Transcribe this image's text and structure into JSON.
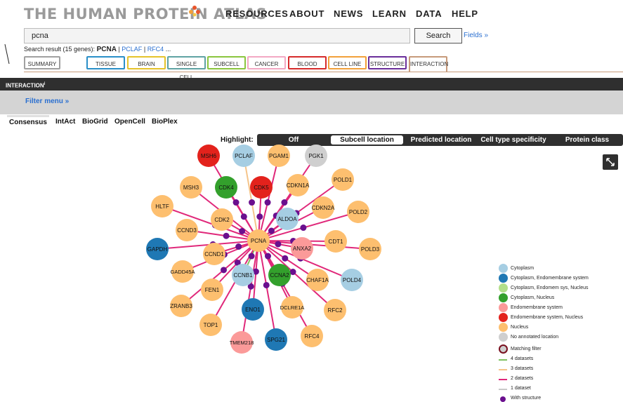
{
  "header": {
    "logo_text": "THE HUMAN PROTEIN ATLAS",
    "nav": [
      "RESOURCES",
      "ABOUT",
      "NEWS",
      "LEARN",
      "DATA",
      "HELP"
    ]
  },
  "search": {
    "value": "pcna",
    "button_label": "Search",
    "fields_link": "Fields »",
    "result_prefix": "Search result (15 genes):",
    "result_main": "PCNA",
    "result_sep1": "|",
    "result_gene2": "PCLAF",
    "result_sep2": "|",
    "result_gene3": "RFC4",
    "result_more": "..."
  },
  "tabs": [
    {
      "label": "SUMMARY",
      "color": "#a0a0a0"
    },
    {
      "label": "TISSUE",
      "color": "#2a8fc8"
    },
    {
      "label": "BRAIN",
      "color": "#e5c32b"
    },
    {
      "label": "SINGLE CELL",
      "color": "#5fa3a3"
    },
    {
      "label": "SUBCELL",
      "color": "#8ac53e"
    },
    {
      "label": "CANCER",
      "color": "#f3a8c3"
    },
    {
      "label": "BLOOD",
      "color": "#d62b2b"
    },
    {
      "label": "CELL LINE",
      "color": "#f2a03a"
    },
    {
      "label": "STRUCTURE",
      "color": "#6a2e9a"
    },
    {
      "label": "INTERACTION",
      "color": "#c79a7a"
    }
  ],
  "section": {
    "title": "INTERACTION",
    "superscript": "i",
    "filter_menu": "Filter menu »"
  },
  "dataset_tabs": [
    "Consensus",
    "IntAct",
    "BioGrid",
    "OpenCell",
    "BioPlex"
  ],
  "highlight": {
    "label": "Highlight:",
    "options": [
      "Off",
      "Subcell location",
      "Predicted location",
      "Cell type specificity",
      "Protein class"
    ],
    "active": "Subcell location"
  },
  "network": {
    "center": {
      "label": "PCNA",
      "color": "#fdbf6f"
    },
    "nodes": [
      {
        "label": "MSH6",
        "color": "#e3221c"
      },
      {
        "label": "PCLAF",
        "color": "#a6cee3"
      },
      {
        "label": "PGAM1",
        "color": "#fdbf6f"
      },
      {
        "label": "PGK1",
        "color": "#cfcfcf"
      },
      {
        "label": "MSH3",
        "color": "#fdbf6f"
      },
      {
        "label": "CDK4",
        "color": "#33a02c"
      },
      {
        "label": "CDK5",
        "color": "#e3221c"
      },
      {
        "label": "CDKN1A",
        "color": "#fdbf6f"
      },
      {
        "label": "POLD1",
        "color": "#fdbf6f"
      },
      {
        "label": "HLTF",
        "color": "#fdbf6f"
      },
      {
        "label": "CDKN2A",
        "color": "#fdbf6f"
      },
      {
        "label": "POLD2",
        "color": "#fdbf6f"
      },
      {
        "label": "CDK2",
        "color": "#fdbf6f"
      },
      {
        "label": "ALDOA",
        "color": "#a6cee3"
      },
      {
        "label": "CCND3",
        "color": "#fdbf6f"
      },
      {
        "label": "CDT1",
        "color": "#fdbf6f"
      },
      {
        "label": "GAPDH",
        "color": "#1f78b4"
      },
      {
        "label": "ANXA2",
        "color": "#fb9a99"
      },
      {
        "label": "POLD3",
        "color": "#fdbf6f"
      },
      {
        "label": "CCND1",
        "color": "#fdbf6f"
      },
      {
        "label": "GADD45A",
        "color": "#fdbf6f"
      },
      {
        "label": "CCNB1",
        "color": "#a6cee3"
      },
      {
        "label": "CCNA2",
        "color": "#33a02c"
      },
      {
        "label": "CHAF1A",
        "color": "#fdbf6f"
      },
      {
        "label": "POLD4",
        "color": "#a6cee3"
      },
      {
        "label": "FEN1",
        "color": "#fdbf6f"
      },
      {
        "label": "ZRANB3",
        "color": "#fdbf6f"
      },
      {
        "label": "ENO1",
        "color": "#1f78b4"
      },
      {
        "label": "DCLRE1A",
        "color": "#fdbf6f"
      },
      {
        "label": "RFC2",
        "color": "#fdbf6f"
      },
      {
        "label": "TOP1",
        "color": "#fdbf6f"
      },
      {
        "label": "TMEM218",
        "color": "#fb9a99"
      },
      {
        "label": "SPG21",
        "color": "#1f78b4"
      },
      {
        "label": "RFC4",
        "color": "#fdbf6f"
      }
    ]
  },
  "legend": {
    "locations": [
      {
        "label": "Cytoplasm",
        "color": "#a6cee3"
      },
      {
        "label": "Cytoplasm, Endomembrane system",
        "color": "#1f78b4"
      },
      {
        "label": "Cytoplasm, Endomem sys, Nucleus",
        "color": "#b2df8a"
      },
      {
        "label": "Cytoplasm, Nucleus",
        "color": "#33a02c"
      },
      {
        "label": "Endomembrane system",
        "color": "#fb9a99"
      },
      {
        "label": "Endomembrane system, Nucleus",
        "color": "#e3221c"
      },
      {
        "label": "Nucleus",
        "color": "#fdbf6f"
      },
      {
        "label": "No annotated location",
        "color": "#cfcfcf"
      }
    ],
    "matching_filter": "Matching filter",
    "datasets": [
      {
        "label": "4 datasets",
        "color": "#7fc060"
      },
      {
        "label": "3 datasets",
        "color": "#f5c48a"
      },
      {
        "label": "2 datasets",
        "color": "#e0287a"
      },
      {
        "label": "1 dataset",
        "color": "#c8c8c8"
      }
    ],
    "with_structure": "With structure",
    "structure_color": "#6a0f8e"
  }
}
